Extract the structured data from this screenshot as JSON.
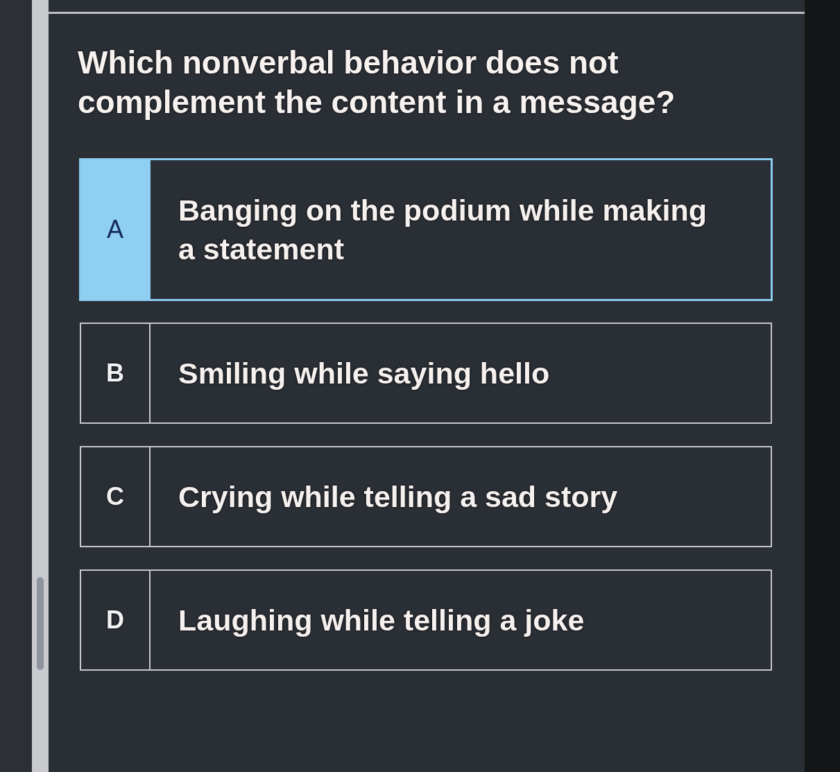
{
  "question": "Which nonverbal behavior does not complement the content in a message?",
  "options": [
    {
      "letter": "A",
      "text": "Banging on the podium while making a statement",
      "selected": true
    },
    {
      "letter": "B",
      "text": "Smiling while saying hello",
      "selected": false
    },
    {
      "letter": "C",
      "text": "Crying while telling a sad story",
      "selected": false
    },
    {
      "letter": "D",
      "text": "Laughing while telling a joke",
      "selected": false
    }
  ]
}
